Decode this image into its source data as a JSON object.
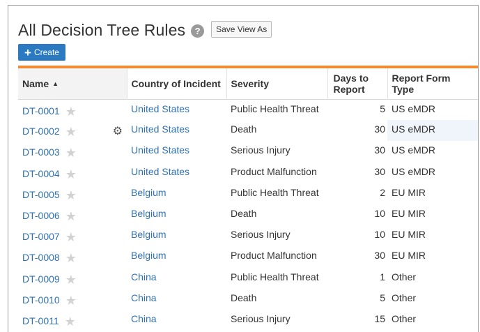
{
  "header": {
    "title": "All Decision Tree Rules",
    "help_icon": "question-circle-icon",
    "save_view_label": "Save View As",
    "create_label": "Create"
  },
  "colors": {
    "accent": "#ef8b35",
    "link": "#2f72b4",
    "primary_button": "#2b7ac1"
  },
  "table": {
    "columns": {
      "name": "Name",
      "country": "Country of Incident",
      "severity": "Severity",
      "days": "Days to Report",
      "form": "Report Form Type"
    },
    "rows": [
      {
        "name": "DT-0001",
        "country": "United States",
        "severity": "Public Health Threat",
        "days": "5",
        "form": "US eMDR"
      },
      {
        "name": "DT-0002",
        "country": "United States",
        "severity": "Death",
        "days": "30",
        "form": "US eMDR"
      },
      {
        "name": "DT-0003",
        "country": "United States",
        "severity": "Serious Injury",
        "days": "30",
        "form": "US eMDR"
      },
      {
        "name": "DT-0004",
        "country": "United States",
        "severity": "Product Malfunction",
        "days": "30",
        "form": "US eMDR"
      },
      {
        "name": "DT-0005",
        "country": "Belgium",
        "severity": "Public Health Threat",
        "days": "2",
        "form": "EU MIR"
      },
      {
        "name": "DT-0006",
        "country": "Belgium",
        "severity": "Death",
        "days": "10",
        "form": "EU MIR"
      },
      {
        "name": "DT-0007",
        "country": "Belgium",
        "severity": "Serious Injury",
        "days": "10",
        "form": "EU MIR"
      },
      {
        "name": "DT-0008",
        "country": "Belgium",
        "severity": "Product Malfunction",
        "days": "30",
        "form": "EU MIR"
      },
      {
        "name": "DT-0009",
        "country": "China",
        "severity": "Public Health Threat",
        "days": "1",
        "form": "Other"
      },
      {
        "name": "DT-0010",
        "country": "China",
        "severity": "Death",
        "days": "5",
        "form": "Other"
      },
      {
        "name": "DT-0011",
        "country": "China",
        "severity": "Serious Injury",
        "days": "15",
        "form": "Other"
      }
    ]
  }
}
